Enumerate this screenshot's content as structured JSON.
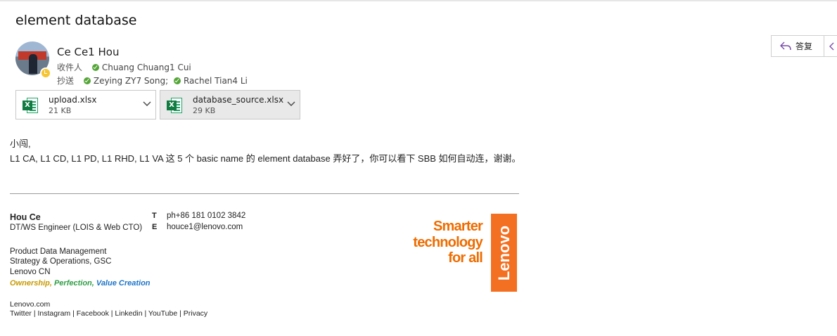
{
  "subject": "element database",
  "sender": {
    "name": "Ce Ce1 Hou"
  },
  "recipients": {
    "to_label": "收件人",
    "to": [
      "Chuang Chuang1 Cui"
    ],
    "cc_label": "抄送",
    "cc": [
      "Zeying ZY7 Song;",
      "Rachel Tian4 Li"
    ]
  },
  "actions": {
    "reply_label": "答复"
  },
  "attachments": [
    {
      "name": "upload.xlsx",
      "size": "21 KB"
    },
    {
      "name": "database_source.xlsx",
      "size": "29 KB"
    }
  ],
  "body": {
    "greeting": "小闯,",
    "line1": "L1 CA, L1 CD, L1 PD, L1 RHD, L1 VA 这 5 个 basic name 的 element database 弄好了，你可以看下 SBB 如何自动连，谢谢。"
  },
  "signature": {
    "name": "Hou Ce",
    "title": "DT/WS Engineer (LOIS & Web CTO)",
    "phone_label": "T",
    "phone": "ph+86 181 0102 3842",
    "email_label": "E",
    "email": "houce1@lenovo.com",
    "dept1": "Product Data Management",
    "dept2": "Strategy & Operations, GSC",
    "dept3": "Lenovo CN",
    "motto": [
      "Ownership,",
      "Perfection,",
      "Value Creation"
    ],
    "motto_colors": [
      "#c79a00",
      "#2f9e44",
      "#1a73c8"
    ],
    "site": "Lenovo.com",
    "links": [
      "Twitter",
      "Instagram",
      "Facebook",
      "Linkedin",
      "YouTube",
      "Privacy"
    ],
    "logo_lines": [
      "Smarter",
      "technology",
      "for all"
    ],
    "logo_brand": "Lenovo"
  },
  "colors": {
    "brand_orange": "#f36f21",
    "excel_green": "#107c41",
    "presence_green": "#54a537"
  }
}
